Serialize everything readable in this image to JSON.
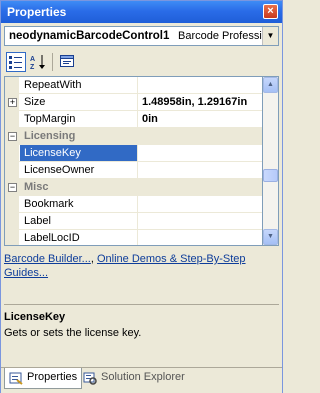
{
  "window": {
    "title": "Properties",
    "close_label": "×"
  },
  "selector": {
    "object_name": "neodynamicBarcodeControl1",
    "object_type": "Barcode Professio"
  },
  "toolbar": {
    "buttons": [
      {
        "name": "categorized-button",
        "label": "▤",
        "active": true
      },
      {
        "name": "alphabetical-button",
        "label": "A↓",
        "active": false
      },
      {
        "name": "property-pages-button",
        "label": "▭",
        "active": false
      }
    ]
  },
  "grid": {
    "rows": [
      {
        "type": "prop",
        "name": "RepeatWith",
        "value": ""
      },
      {
        "type": "prop",
        "name": "Size",
        "value": "1.48958in, 1.29167in",
        "expandable": true
      },
      {
        "type": "prop",
        "name": "TopMargin",
        "value": "0in"
      },
      {
        "type": "cat",
        "name": "Licensing"
      },
      {
        "type": "prop",
        "name": "LicenseKey",
        "value": "",
        "selected": true
      },
      {
        "type": "prop",
        "name": "LicenseOwner",
        "value": ""
      },
      {
        "type": "cat",
        "name": "Misc"
      },
      {
        "type": "prop",
        "name": "Bookmark",
        "value": ""
      },
      {
        "type": "prop",
        "name": "Label",
        "value": ""
      },
      {
        "type": "prop",
        "name": "LabelLocID",
        "value": ""
      }
    ],
    "expand_symbol": "+",
    "collapse_symbol": "−"
  },
  "scrollbar": {
    "up_arrow": "▲",
    "down_arrow": "▼",
    "position": 0.62
  },
  "commands": {
    "link1": "Barcode Builder...",
    "separator": ",",
    "link2": "Online Demos & Step-By-Step Guides..."
  },
  "description": {
    "title": "LicenseKey",
    "text": "Gets or sets the license key."
  },
  "tabs": [
    {
      "label": "Properties",
      "active": true
    },
    {
      "label": "Solution Explorer",
      "active": false
    }
  ]
}
